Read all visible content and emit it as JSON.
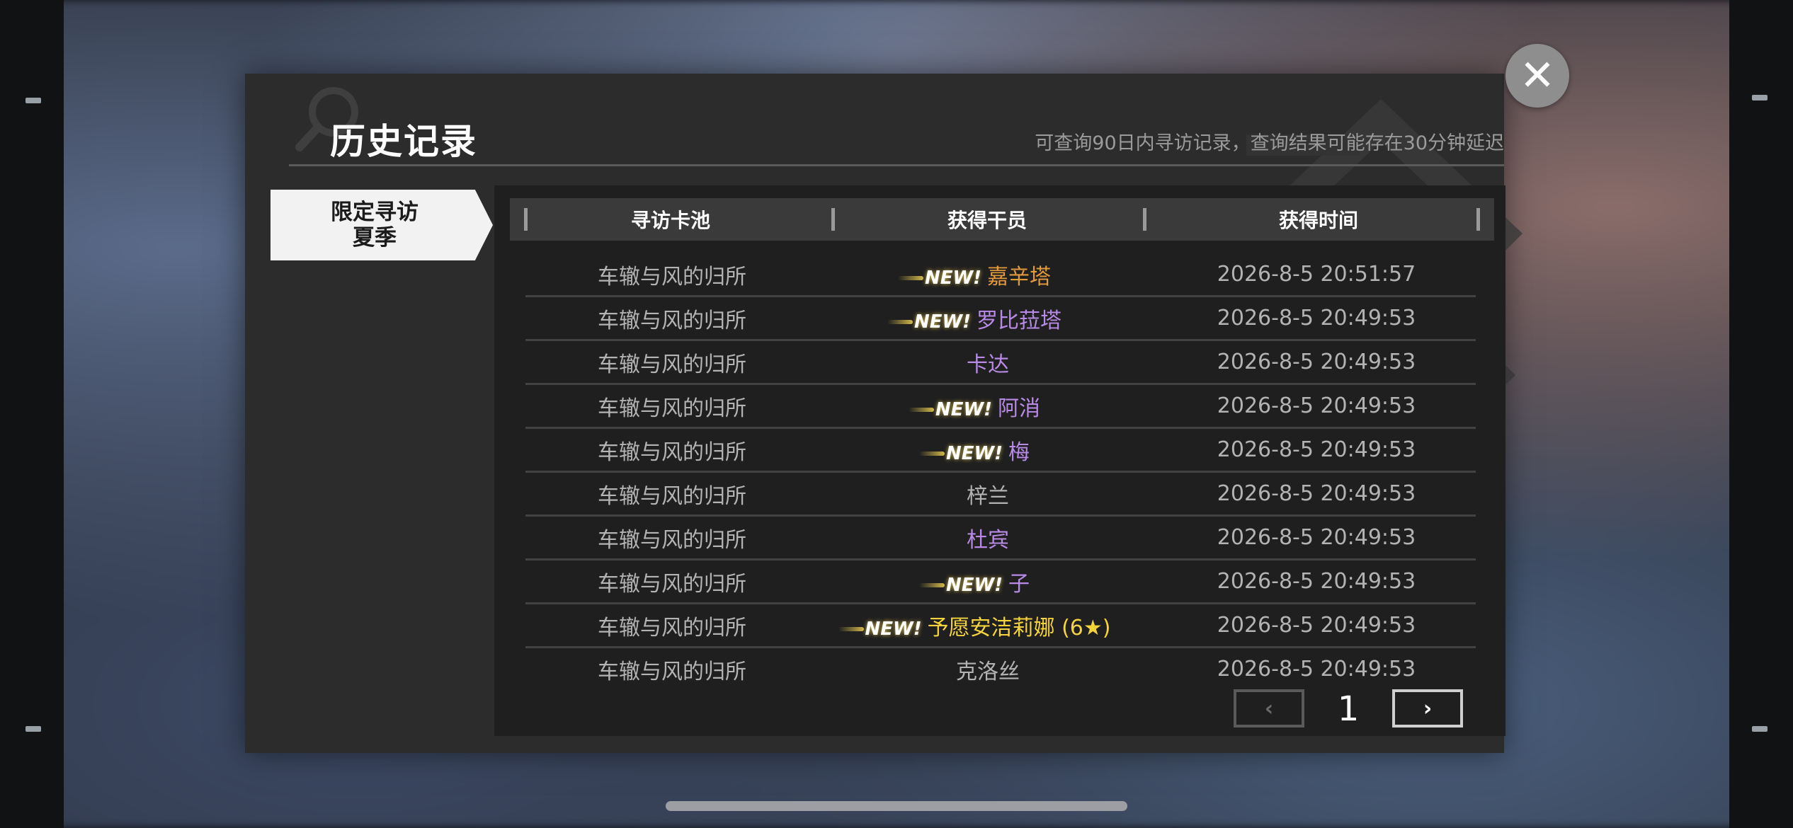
{
  "header": {
    "title": "历史记录",
    "subtitle": "可查询90日内寻访记录，查询结果可能存在30分钟延迟",
    "close_label": "✕"
  },
  "sidebar": {
    "tab_line1": "限定寻访",
    "tab_line2": "夏季"
  },
  "table": {
    "columns": [
      "寻访卡池",
      "获得干员",
      "获得时间"
    ],
    "new_label": "NEW!",
    "rows": [
      {
        "pool": "车辙与风的归所",
        "operator": "嘉辛塔",
        "time": "2026-8-5 20:51:57",
        "is_new": true,
        "color": "#e39a3b"
      },
      {
        "pool": "车辙与风的归所",
        "operator": "罗比菈塔",
        "time": "2026-8-5 20:49:53",
        "is_new": true,
        "color": "#b88ae6"
      },
      {
        "pool": "车辙与风的归所",
        "operator": "卡达",
        "time": "2026-8-5 20:49:53",
        "is_new": false,
        "color": "#b88ae6"
      },
      {
        "pool": "车辙与风的归所",
        "operator": "阿消",
        "time": "2026-8-5 20:49:53",
        "is_new": true,
        "color": "#b88ae6"
      },
      {
        "pool": "车辙与风的归所",
        "operator": "梅",
        "time": "2026-8-5 20:49:53",
        "is_new": true,
        "color": "#b88ae6"
      },
      {
        "pool": "车辙与风的归所",
        "operator": "梓兰",
        "time": "2026-8-5 20:49:53",
        "is_new": false,
        "color": "#b3b3b3"
      },
      {
        "pool": "车辙与风的归所",
        "operator": "杜宾",
        "time": "2026-8-5 20:49:53",
        "is_new": false,
        "color": "#b88ae6"
      },
      {
        "pool": "车辙与风的归所",
        "operator": "子",
        "time": "2026-8-5 20:49:53",
        "is_new": true,
        "color": "#b88ae6"
      },
      {
        "pool": "车辙与风的归所",
        "operator": "予愿安洁莉娜 (6★)",
        "time": "2026-8-5 20:49:53",
        "is_new": true,
        "color": "#f5d33a"
      },
      {
        "pool": "车辙与风的归所",
        "operator": "克洛丝",
        "time": "2026-8-5 20:49:53",
        "is_new": false,
        "color": "#b3b3b3"
      }
    ]
  },
  "pager": {
    "current_page": "1",
    "prev_label": "‹",
    "next_label": "›"
  },
  "icons": {
    "close": "close-icon",
    "search_deco": "search-icon",
    "prev": "chevron-left-icon",
    "next": "chevron-right-icon"
  }
}
